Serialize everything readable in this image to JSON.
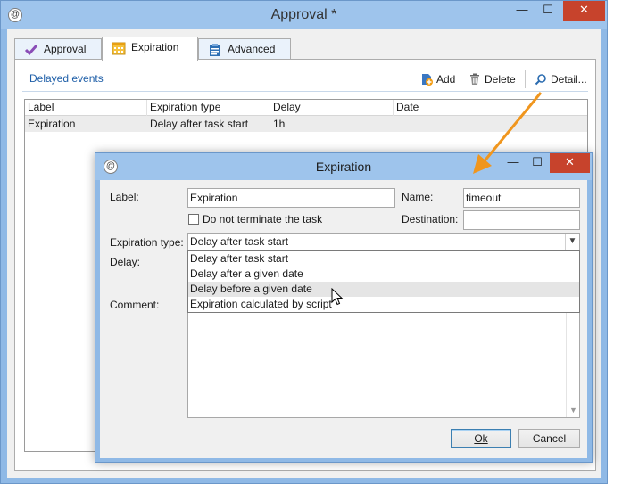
{
  "outer_window": {
    "title": "Approval *",
    "controls": {
      "minimize": "—",
      "maximize": "☐",
      "close": "✕"
    }
  },
  "tabs": [
    {
      "label": "Approval",
      "icon": "checkmark-icon",
      "active": false
    },
    {
      "label": "Expiration",
      "icon": "calendar-icon",
      "active": true
    },
    {
      "label": "Advanced",
      "icon": "clipboard-icon",
      "active": false
    }
  ],
  "panel": {
    "title": "Delayed events",
    "toolbar": {
      "add": "Add",
      "delete": "Delete",
      "detail": "Detail..."
    }
  },
  "grid": {
    "columns": [
      "Label",
      "Expiration type",
      "Delay",
      "Date"
    ],
    "rows": [
      {
        "label": "Expiration",
        "expiration_type": "Delay after task start",
        "delay": "1h",
        "date": ""
      }
    ]
  },
  "dialog": {
    "title": "Expiration",
    "controls": {
      "minimize": "—",
      "maximize": "☐",
      "close": "✕"
    },
    "label_caption": "Label:",
    "label_value": "Expiration",
    "name_caption": "Name:",
    "name_value": "timeout",
    "no_terminate_label": "Do not terminate the task",
    "no_terminate_checked": false,
    "destination_caption": "Destination:",
    "destination_value": "",
    "expiration_type_caption": "Expiration type:",
    "expiration_type_value": "Delay after task start",
    "expiration_type_options": [
      "Delay after task start",
      "Delay after a given date",
      "Delay before a given date",
      "Expiration calculated by script"
    ],
    "hovered_option": "Delay before a given date",
    "delay_caption": "Delay:",
    "comment_caption": "Comment:",
    "comment_value": "",
    "ok_label": "Ok",
    "cancel_label": "Cancel"
  },
  "colors": {
    "title_bar": "#9ec4ec",
    "close_button": "#c7432c",
    "link_blue": "#1f5fa8",
    "annotation_arrow": "#f0961e"
  }
}
